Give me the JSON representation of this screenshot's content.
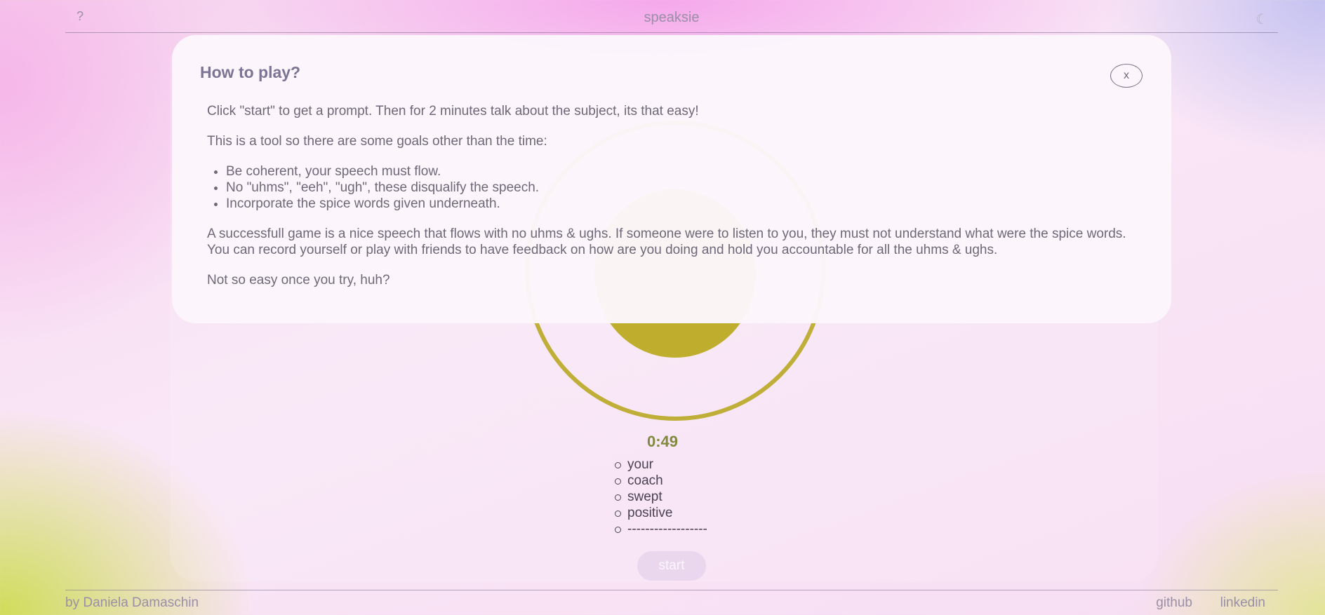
{
  "header": {
    "help_label": "?",
    "title": "speaksie",
    "theme_toggle_label": "☾"
  },
  "game": {
    "timer": "0:49",
    "spice_words": [
      "your",
      "coach",
      "swept",
      "positive",
      "------------------"
    ],
    "start_label": "start",
    "accent_color": "#bfae2d"
  },
  "footer": {
    "author": "by Daniela Damaschin",
    "links": [
      "github",
      "linkedin"
    ]
  },
  "modal": {
    "title": "How to play?",
    "close_label": "x",
    "intro": "Click \"start\" to get a prompt. Then for 2 minutes talk about the subject, its that easy!",
    "goals_intro": "This is a tool so there are some goals other than the time:",
    "goals": [
      "Be coherent, your speech must flow.",
      "No \"uhms\", \"eeh\", \"ugh\", these disqualify the speech.",
      "Incorporate the spice words given underneath."
    ],
    "success": "A successfull game is a nice speech that flows with no uhms & ughs. If someone were to listen to you, they must not understand what were the spice words. You can record yourself or play with friends to have feedback on how are you doing and hold you accountable for all the uhms & ughs.",
    "outro": "Not so easy once you try, huh?"
  }
}
